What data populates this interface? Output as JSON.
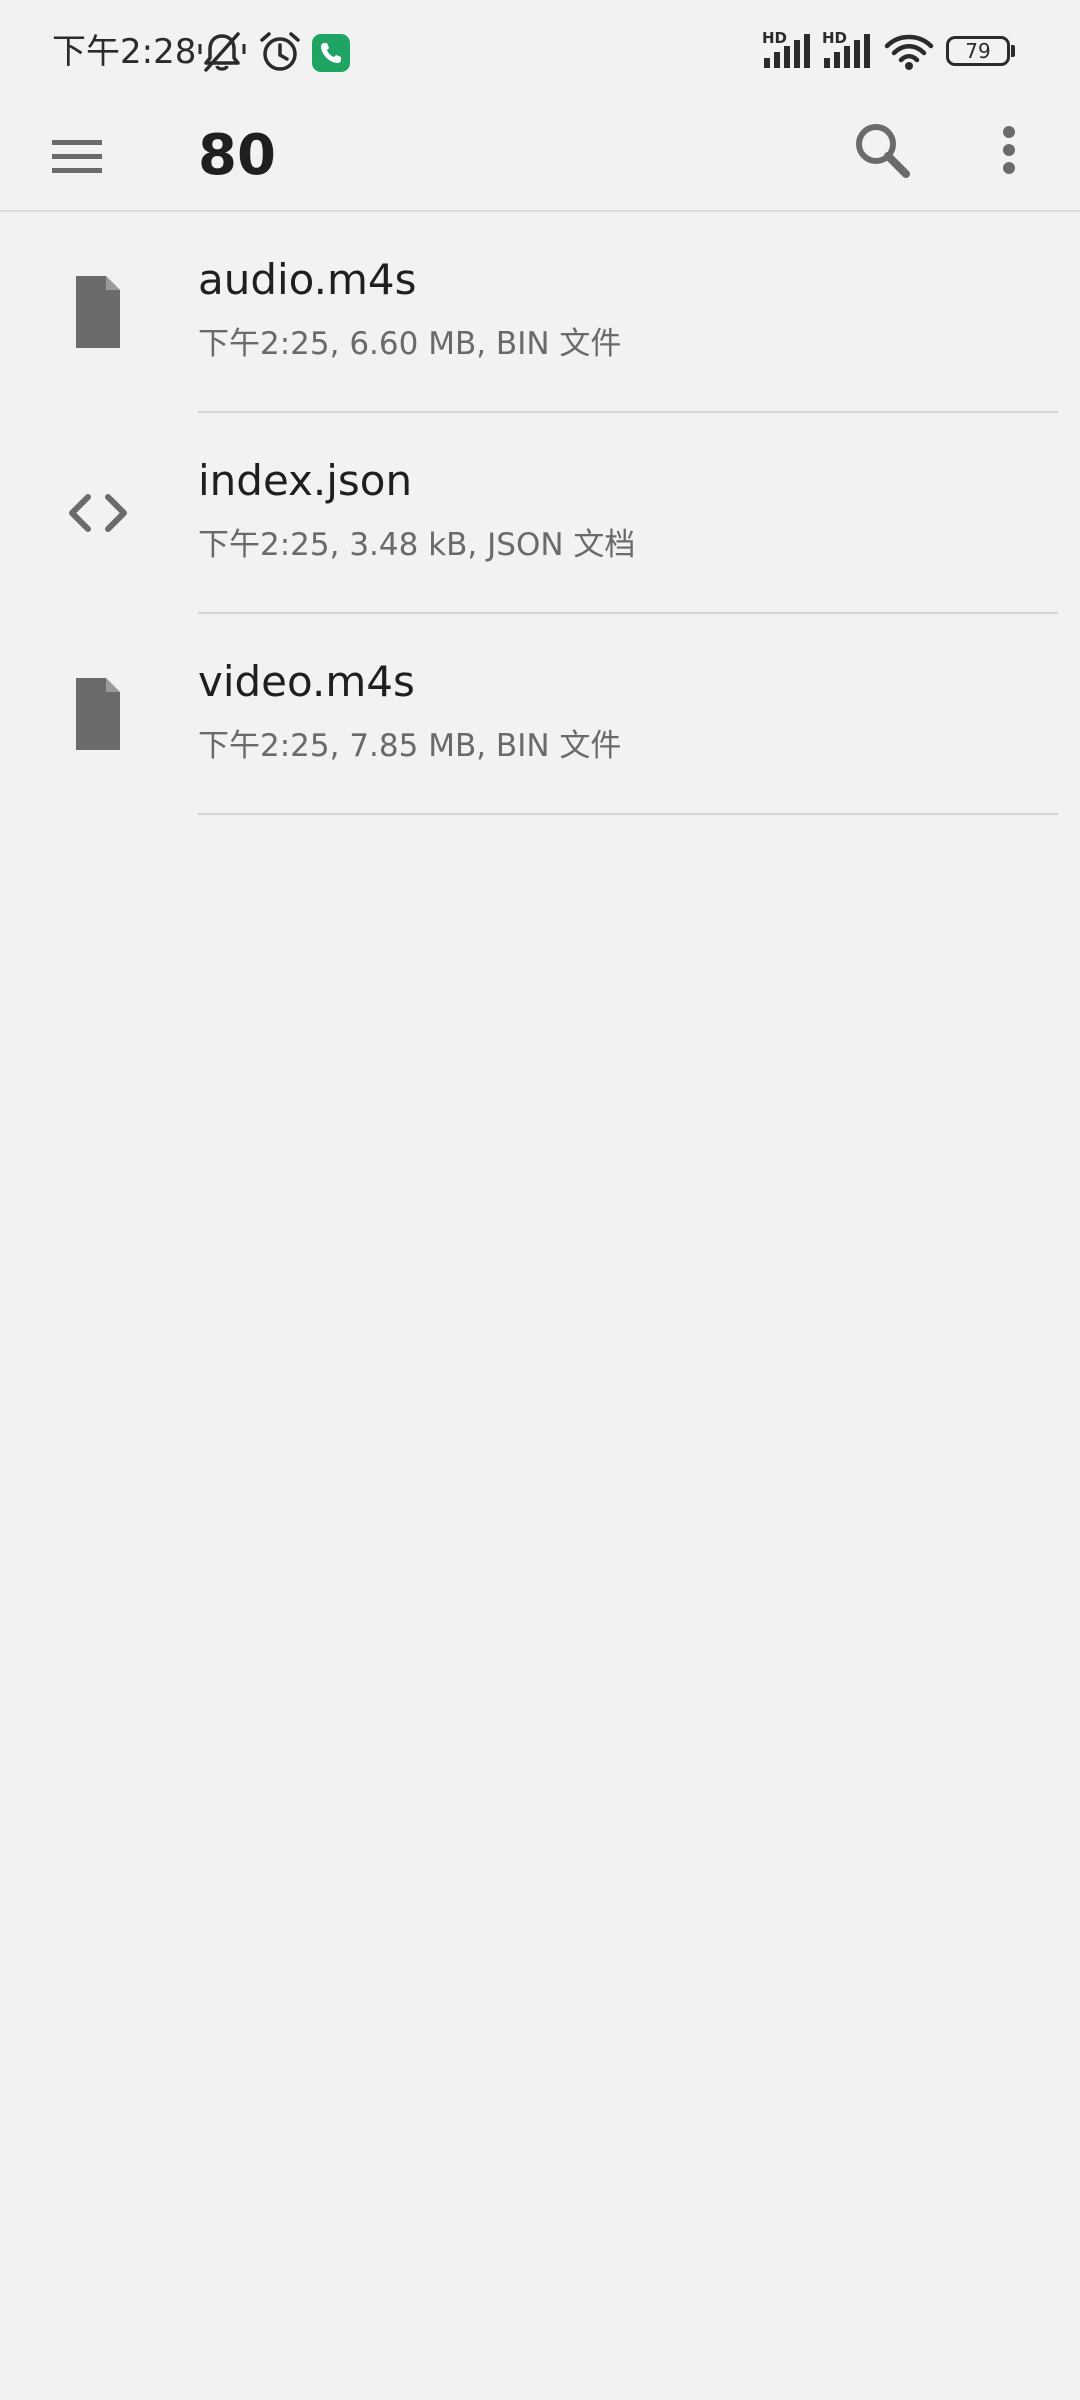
{
  "status_bar": {
    "time": "下午2:28",
    "battery": "79",
    "network_badge_1": "HD",
    "network_badge_2": "HD",
    "icons": [
      "mute-icon",
      "alarm-icon",
      "call-icon",
      "signal-icon",
      "signal-icon",
      "wifi-icon",
      "battery-icon"
    ],
    "call_icon_color": "#1fa463"
  },
  "app_bar": {
    "title": "80",
    "icons": [
      "menu-icon",
      "search-icon",
      "more-vert-icon"
    ]
  },
  "files": [
    {
      "name": "audio.m4s",
      "meta": "下午2:25, 6.60 MB, BIN 文件",
      "icon": "file-icon"
    },
    {
      "name": "index.json",
      "meta": "下午2:25, 3.48 kB, JSON 文档",
      "icon": "code-icon"
    },
    {
      "name": "video.m4s",
      "meta": "下午2:25, 7.85 MB, BIN 文件",
      "icon": "file-icon"
    }
  ],
  "colors": {
    "background": "#f2f2f2",
    "icon": "#6b6b6b",
    "divider": "#d6d6d6",
    "text_primary": "#1f1f1f",
    "text_secondary": "#6a6a6a"
  }
}
